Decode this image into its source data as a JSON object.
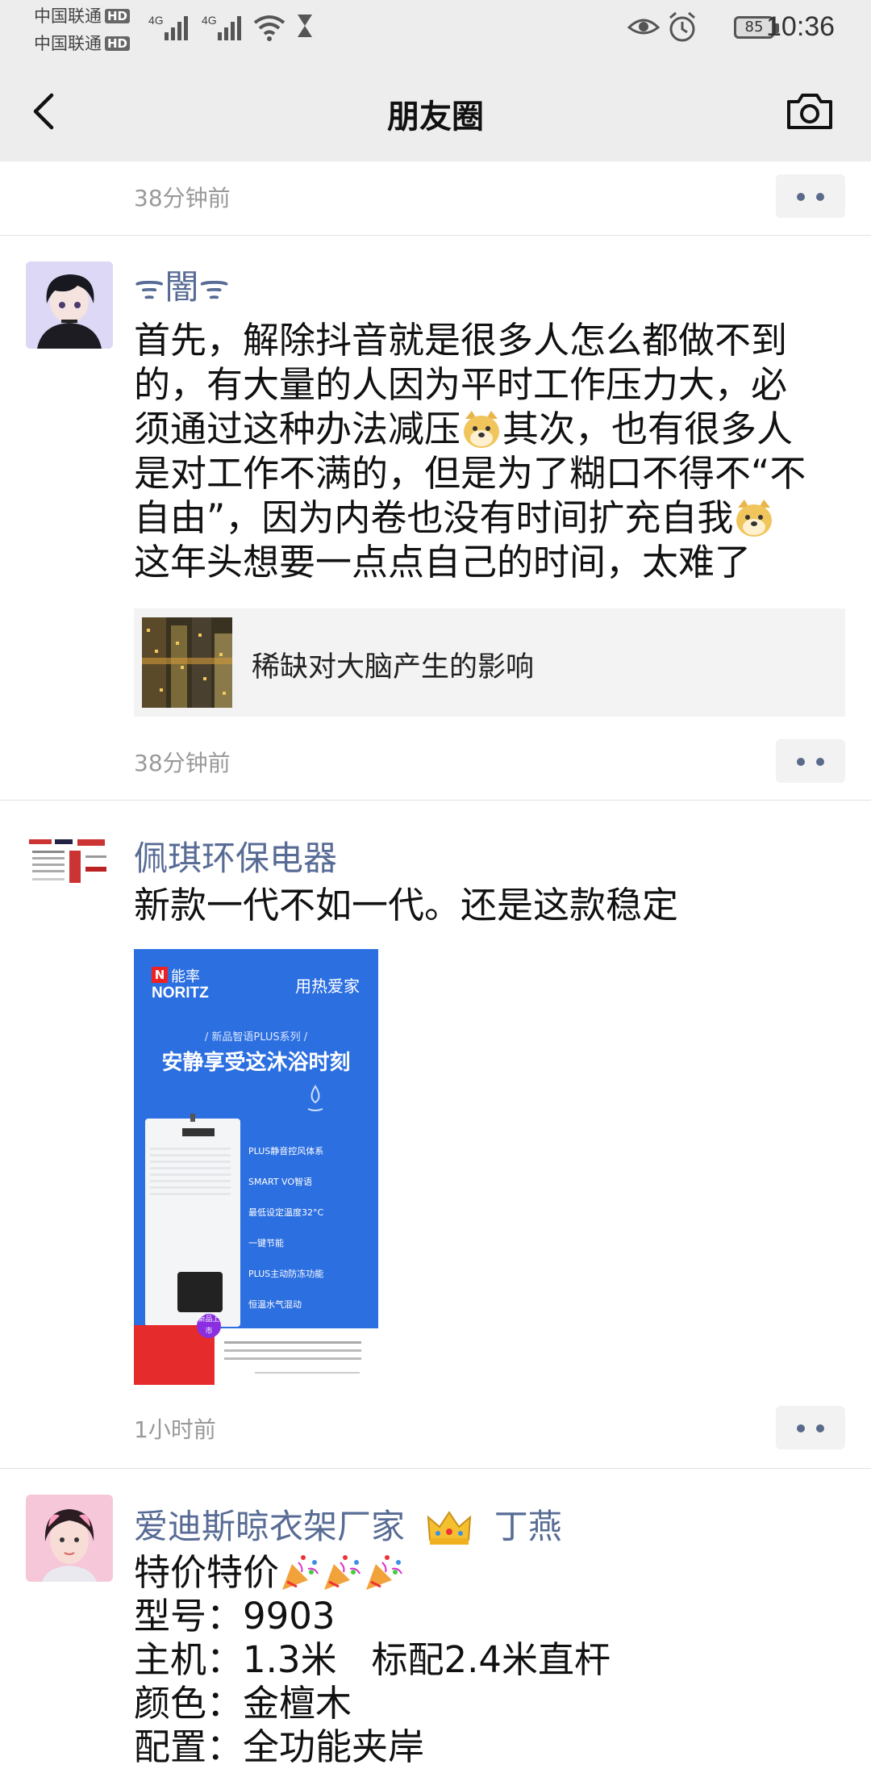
{
  "status_bar": {
    "carrier1": "中国联通",
    "carrier2": "中国联通",
    "hd": "HD",
    "net1": "4G",
    "net2": "4G",
    "battery": "85",
    "time": "10:36"
  },
  "nav": {
    "title": "朋友圈"
  },
  "posts": [
    {
      "time": "38分钟前"
    },
    {
      "author": "ᯤ闇ᯤ",
      "text": [
        "首先，解除抖音就是很多人怎么都做不到",
        "的，有大量的人因为平时工作压力大，必",
        "须通过这种办法减压",
        "其次，也有很多人",
        "是对工作不满的，但是为了糊口不得不“不",
        "自由”，因为内卷也没有时间扩充自我",
        "这年头想要一点点自己的时间，太难了"
      ],
      "link_title": "稀缺对大脑产生的影响",
      "time": "38分钟前"
    },
    {
      "author": "佩琪环保电器",
      "text": "新款一代不如一代。还是这款稳定",
      "ad": {
        "brand_cn": "能率",
        "brand_en": "NORITZ",
        "slogan": "用热爱家",
        "series": "/ 新品智语PLUS系列 /",
        "headline": "安静享受这沐浴时刻",
        "features": [
          "PLUS静音控风体系",
          "SMART VO智语",
          "最低设定温度32°C",
          "一键节能",
          "PLUS主动防冻功能",
          "恒温水气混动"
        ],
        "badge": "新品上市"
      },
      "time": "1小时前"
    },
    {
      "author": "爱迪斯晾衣架厂家",
      "author2": "丁燕",
      "lines": [
        "特价特价",
        "型号：9903",
        "主机：1.3米   标配2.4米直杆",
        "颜色：金檀木",
        "配置：全功能夹岸"
      ]
    }
  ],
  "colors": {
    "accent": "#576b95",
    "bg_bar": "#ededed",
    "time_gray": "#999999"
  }
}
